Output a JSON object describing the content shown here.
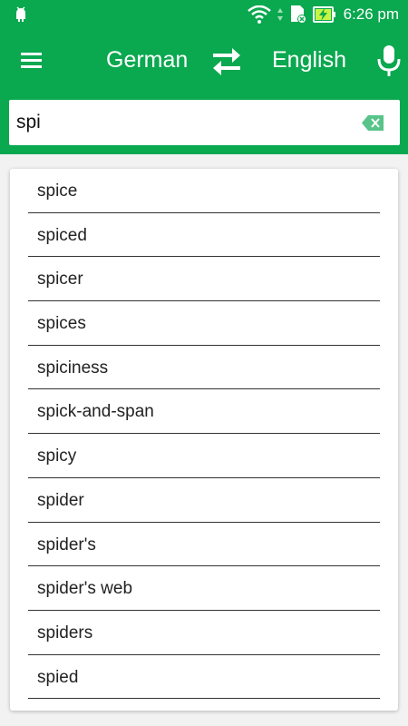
{
  "statusbar": {
    "time": "6:26 pm",
    "icons": [
      "android-icon",
      "wifi-icon",
      "sim-icon",
      "battery-charging-icon"
    ]
  },
  "appbar": {
    "menu_icon": "hamburger-menu-icon",
    "source_language": "German",
    "target_language": "English",
    "swap_icon": "swap-arrows-icon",
    "mic_icon": "microphone-icon"
  },
  "search": {
    "value": "spi",
    "clear_icon": "backspace-clear-icon"
  },
  "suggestions": [
    "spice",
    "spiced",
    "spicer",
    "spices",
    "spiciness",
    "spick-and-span",
    "spicy",
    "spider",
    "spider's",
    "spider's web",
    "spiders",
    "spied"
  ],
  "colors": {
    "accent": "#0aa84f",
    "background": "#f2f2f2"
  }
}
